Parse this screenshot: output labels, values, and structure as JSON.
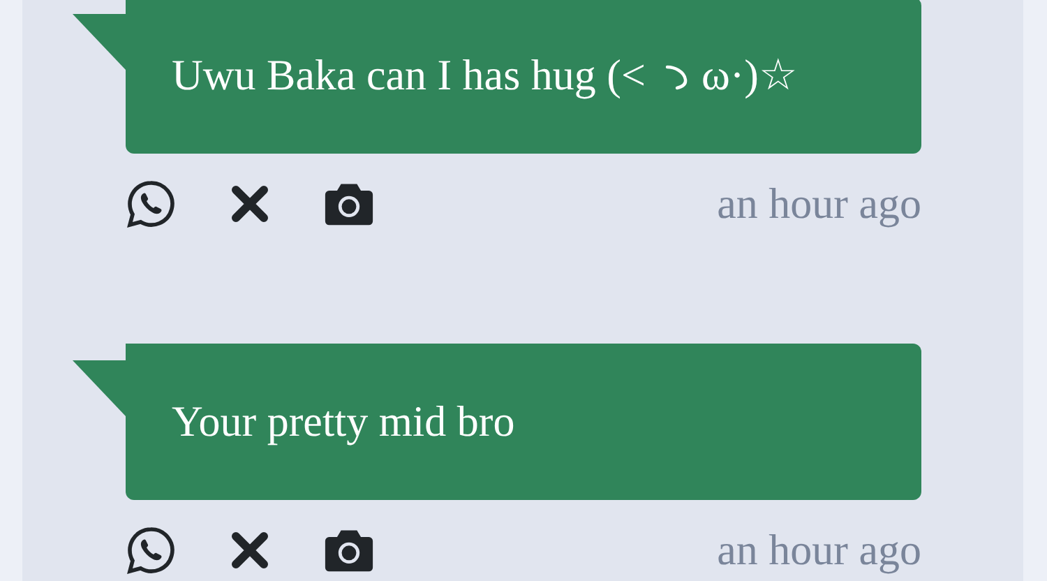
{
  "messages": [
    {
      "parts": [
        {
          "kind": "text",
          "text": "Uwu Baka can I has hug (<"
        },
        {
          "kind": "glyph"
        },
        {
          "kind": "text",
          "text": "ω·)☆"
        }
      ],
      "time": "an hour ago"
    },
    {
      "parts": [
        {
          "kind": "text",
          "text": "Your pretty mid bro"
        }
      ],
      "time": "an hour ago"
    }
  ]
}
